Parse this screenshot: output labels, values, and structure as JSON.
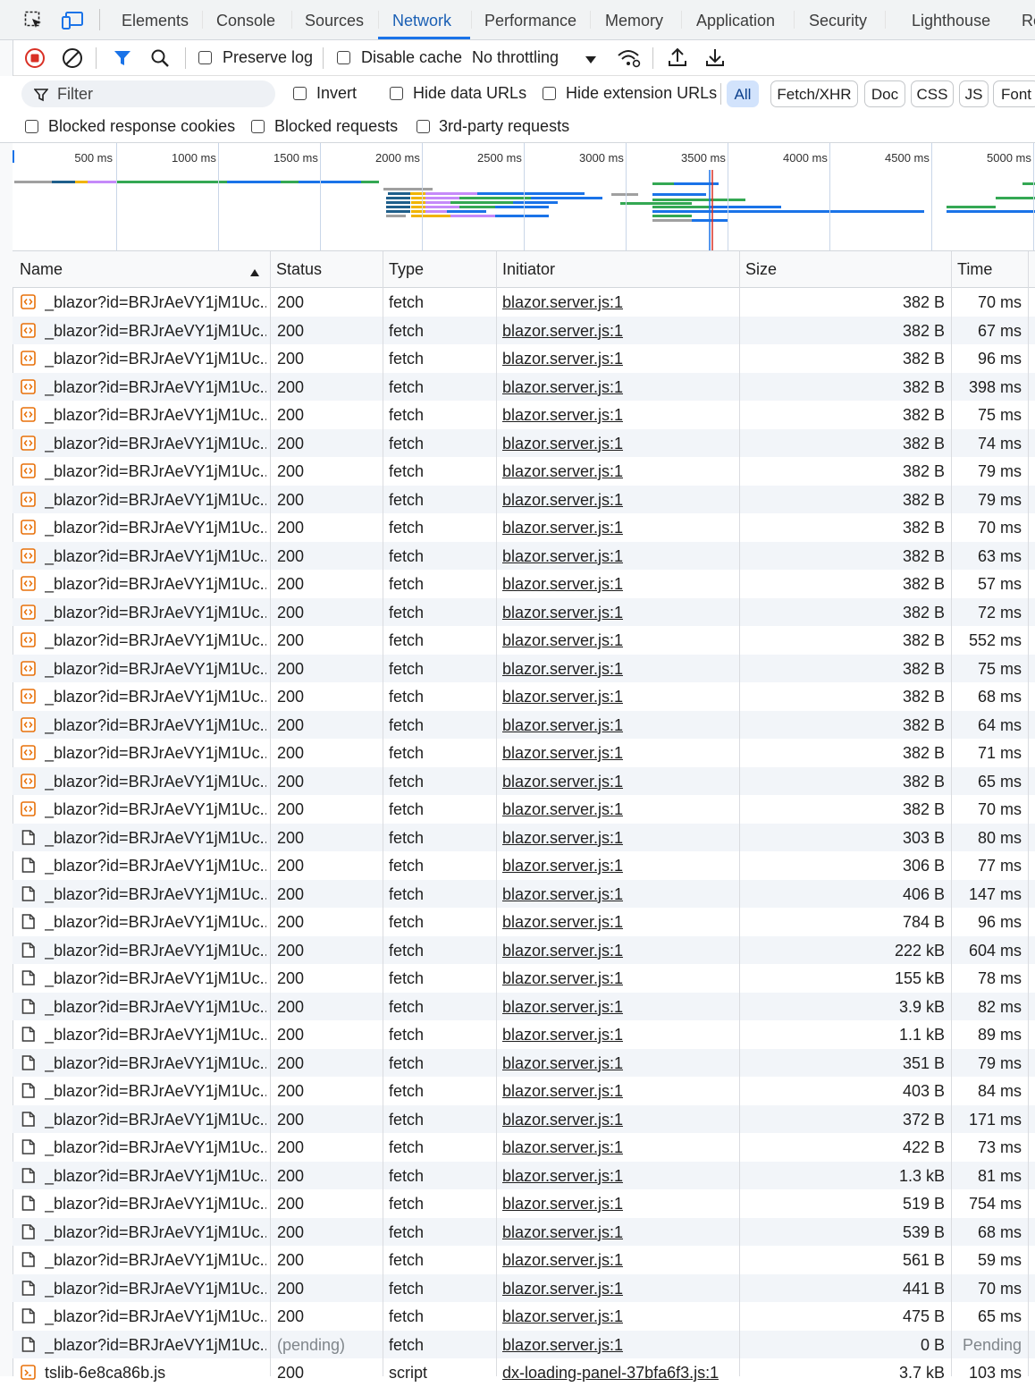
{
  "tabs": [
    {
      "label": "Elements"
    },
    {
      "label": "Console"
    },
    {
      "label": "Sources"
    },
    {
      "label": "Network"
    },
    {
      "label": "Performance"
    },
    {
      "label": "Memory"
    },
    {
      "label": "Application"
    },
    {
      "label": "Security"
    },
    {
      "label": "Lighthouse"
    },
    {
      "label": "Re"
    }
  ],
  "active_tab": "Network",
  "toolbar": {
    "preserve_log": "Preserve log",
    "disable_cache": "Disable cache",
    "throttling": "No throttling"
  },
  "filter": {
    "placeholder": "Filter",
    "invert": "Invert",
    "hide_data_urls": "Hide data URLs",
    "hide_extension_urls": "Hide extension URLs",
    "type_buttons": [
      "All",
      "Fetch/XHR",
      "Doc",
      "CSS",
      "JS",
      "Font"
    ],
    "active_type": "All",
    "blocked_response_cookies": "Blocked response cookies",
    "blocked_requests": "Blocked requests",
    "third_party_requests": "3rd-party requests"
  },
  "overview": {
    "ticks": [
      "500 ms",
      "1000 ms",
      "1500 ms",
      "2000 ms",
      "2500 ms",
      "3000 ms",
      "3500 ms",
      "4000 ms",
      "4500 ms",
      "5000 ms"
    ]
  },
  "columns": [
    "Name",
    "Status",
    "Type",
    "Initiator",
    "Size",
    "Time"
  ],
  "sort": {
    "column": "Name",
    "direction": "ascending"
  },
  "rows": [
    {
      "icon": "fetch",
      "name": "_blazor?id=BRJrAeVY1jM1Uc...",
      "status": "200",
      "type": "fetch",
      "initiator": "blazor.server.js:1",
      "size": "382 B",
      "time": "70 ms"
    },
    {
      "icon": "fetch",
      "name": "_blazor?id=BRJrAeVY1jM1Uc...",
      "status": "200",
      "type": "fetch",
      "initiator": "blazor.server.js:1",
      "size": "382 B",
      "time": "67 ms"
    },
    {
      "icon": "fetch",
      "name": "_blazor?id=BRJrAeVY1jM1Uc...",
      "status": "200",
      "type": "fetch",
      "initiator": "blazor.server.js:1",
      "size": "382 B",
      "time": "96 ms"
    },
    {
      "icon": "fetch",
      "name": "_blazor?id=BRJrAeVY1jM1Uc...",
      "status": "200",
      "type": "fetch",
      "initiator": "blazor.server.js:1",
      "size": "382 B",
      "time": "398 ms"
    },
    {
      "icon": "fetch",
      "name": "_blazor?id=BRJrAeVY1jM1Uc...",
      "status": "200",
      "type": "fetch",
      "initiator": "blazor.server.js:1",
      "size": "382 B",
      "time": "75 ms"
    },
    {
      "icon": "fetch",
      "name": "_blazor?id=BRJrAeVY1jM1Uc...",
      "status": "200",
      "type": "fetch",
      "initiator": "blazor.server.js:1",
      "size": "382 B",
      "time": "74 ms"
    },
    {
      "icon": "fetch",
      "name": "_blazor?id=BRJrAeVY1jM1Uc...",
      "status": "200",
      "type": "fetch",
      "initiator": "blazor.server.js:1",
      "size": "382 B",
      "time": "79 ms"
    },
    {
      "icon": "fetch",
      "name": "_blazor?id=BRJrAeVY1jM1Uc...",
      "status": "200",
      "type": "fetch",
      "initiator": "blazor.server.js:1",
      "size": "382 B",
      "time": "79 ms"
    },
    {
      "icon": "fetch",
      "name": "_blazor?id=BRJrAeVY1jM1Uc...",
      "status": "200",
      "type": "fetch",
      "initiator": "blazor.server.js:1",
      "size": "382 B",
      "time": "70 ms"
    },
    {
      "icon": "fetch",
      "name": "_blazor?id=BRJrAeVY1jM1Uc...",
      "status": "200",
      "type": "fetch",
      "initiator": "blazor.server.js:1",
      "size": "382 B",
      "time": "63 ms"
    },
    {
      "icon": "fetch",
      "name": "_blazor?id=BRJrAeVY1jM1Uc...",
      "status": "200",
      "type": "fetch",
      "initiator": "blazor.server.js:1",
      "size": "382 B",
      "time": "57 ms"
    },
    {
      "icon": "fetch",
      "name": "_blazor?id=BRJrAeVY1jM1Uc...",
      "status": "200",
      "type": "fetch",
      "initiator": "blazor.server.js:1",
      "size": "382 B",
      "time": "72 ms"
    },
    {
      "icon": "fetch",
      "name": "_blazor?id=BRJrAeVY1jM1Uc...",
      "status": "200",
      "type": "fetch",
      "initiator": "blazor.server.js:1",
      "size": "382 B",
      "time": "552 ms"
    },
    {
      "icon": "fetch",
      "name": "_blazor?id=BRJrAeVY1jM1Uc...",
      "status": "200",
      "type": "fetch",
      "initiator": "blazor.server.js:1",
      "size": "382 B",
      "time": "75 ms"
    },
    {
      "icon": "fetch",
      "name": "_blazor?id=BRJrAeVY1jM1Uc...",
      "status": "200",
      "type": "fetch",
      "initiator": "blazor.server.js:1",
      "size": "382 B",
      "time": "68 ms"
    },
    {
      "icon": "fetch",
      "name": "_blazor?id=BRJrAeVY1jM1Uc...",
      "status": "200",
      "type": "fetch",
      "initiator": "blazor.server.js:1",
      "size": "382 B",
      "time": "64 ms"
    },
    {
      "icon": "fetch",
      "name": "_blazor?id=BRJrAeVY1jM1Uc...",
      "status": "200",
      "type": "fetch",
      "initiator": "blazor.server.js:1",
      "size": "382 B",
      "time": "71 ms"
    },
    {
      "icon": "fetch",
      "name": "_blazor?id=BRJrAeVY1jM1Uc...",
      "status": "200",
      "type": "fetch",
      "initiator": "blazor.server.js:1",
      "size": "382 B",
      "time": "65 ms"
    },
    {
      "icon": "fetch",
      "name": "_blazor?id=BRJrAeVY1jM1Uc...",
      "status": "200",
      "type": "fetch",
      "initiator": "blazor.server.js:1",
      "size": "382 B",
      "time": "70 ms"
    },
    {
      "icon": "document",
      "name": "_blazor?id=BRJrAeVY1jM1Uc...",
      "status": "200",
      "type": "fetch",
      "initiator": "blazor.server.js:1",
      "size": "303 B",
      "time": "80 ms"
    },
    {
      "icon": "document",
      "name": "_blazor?id=BRJrAeVY1jM1Uc...",
      "status": "200",
      "type": "fetch",
      "initiator": "blazor.server.js:1",
      "size": "306 B",
      "time": "77 ms"
    },
    {
      "icon": "document",
      "name": "_blazor?id=BRJrAeVY1jM1Uc...",
      "status": "200",
      "type": "fetch",
      "initiator": "blazor.server.js:1",
      "size": "406 B",
      "time": "147 ms"
    },
    {
      "icon": "document",
      "name": "_blazor?id=BRJrAeVY1jM1Uc...",
      "status": "200",
      "type": "fetch",
      "initiator": "blazor.server.js:1",
      "size": "784 B",
      "time": "96 ms"
    },
    {
      "icon": "document",
      "name": "_blazor?id=BRJrAeVY1jM1Uc...",
      "status": "200",
      "type": "fetch",
      "initiator": "blazor.server.js:1",
      "size": "222 kB",
      "time": "604 ms"
    },
    {
      "icon": "document",
      "name": "_blazor?id=BRJrAeVY1jM1Uc...",
      "status": "200",
      "type": "fetch",
      "initiator": "blazor.server.js:1",
      "size": "155 kB",
      "time": "78 ms"
    },
    {
      "icon": "document",
      "name": "_blazor?id=BRJrAeVY1jM1Uc...",
      "status": "200",
      "type": "fetch",
      "initiator": "blazor.server.js:1",
      "size": "3.9 kB",
      "time": "82 ms"
    },
    {
      "icon": "document",
      "name": "_blazor?id=BRJrAeVY1jM1Uc...",
      "status": "200",
      "type": "fetch",
      "initiator": "blazor.server.js:1",
      "size": "1.1 kB",
      "time": "89 ms"
    },
    {
      "icon": "document",
      "name": "_blazor?id=BRJrAeVY1jM1Uc...",
      "status": "200",
      "type": "fetch",
      "initiator": "blazor.server.js:1",
      "size": "351 B",
      "time": "79 ms"
    },
    {
      "icon": "document",
      "name": "_blazor?id=BRJrAeVY1jM1Uc...",
      "status": "200",
      "type": "fetch",
      "initiator": "blazor.server.js:1",
      "size": "403 B",
      "time": "84 ms"
    },
    {
      "icon": "document",
      "name": "_blazor?id=BRJrAeVY1jM1Uc...",
      "status": "200",
      "type": "fetch",
      "initiator": "blazor.server.js:1",
      "size": "372 B",
      "time": "171 ms"
    },
    {
      "icon": "document",
      "name": "_blazor?id=BRJrAeVY1jM1Uc...",
      "status": "200",
      "type": "fetch",
      "initiator": "blazor.server.js:1",
      "size": "422 B",
      "time": "73 ms"
    },
    {
      "icon": "document",
      "name": "_blazor?id=BRJrAeVY1jM1Uc...",
      "status": "200",
      "type": "fetch",
      "initiator": "blazor.server.js:1",
      "size": "1.3 kB",
      "time": "81 ms"
    },
    {
      "icon": "document",
      "name": "_blazor?id=BRJrAeVY1jM1Uc...",
      "status": "200",
      "type": "fetch",
      "initiator": "blazor.server.js:1",
      "size": "519 B",
      "time": "754 ms"
    },
    {
      "icon": "document",
      "name": "_blazor?id=BRJrAeVY1jM1Uc...",
      "status": "200",
      "type": "fetch",
      "initiator": "blazor.server.js:1",
      "size": "539 B",
      "time": "68 ms"
    },
    {
      "icon": "document",
      "name": "_blazor?id=BRJrAeVY1jM1Uc...",
      "status": "200",
      "type": "fetch",
      "initiator": "blazor.server.js:1",
      "size": "561 B",
      "time": "59 ms"
    },
    {
      "icon": "document",
      "name": "_blazor?id=BRJrAeVY1jM1Uc...",
      "status": "200",
      "type": "fetch",
      "initiator": "blazor.server.js:1",
      "size": "441 B",
      "time": "70 ms"
    },
    {
      "icon": "document",
      "name": "_blazor?id=BRJrAeVY1jM1Uc...",
      "status": "200",
      "type": "fetch",
      "initiator": "blazor.server.js:1",
      "size": "475 B",
      "time": "65 ms"
    },
    {
      "icon": "document",
      "name": "_blazor?id=BRJrAeVY1jM1Uc...",
      "status": "(pending)",
      "type": "fetch",
      "initiator": "blazor.server.js:1",
      "size": "0 B",
      "time": "Pending"
    },
    {
      "icon": "script",
      "name": "tslib-6e8ca86b.js",
      "status": "200",
      "type": "script",
      "initiator": "dx-loading-panel-37bfa6f3.js:1",
      "size": "3.7 kB",
      "time": "103 ms"
    }
  ],
  "colors": {
    "accent": "#1a73e8",
    "record_red": "#d93025",
    "fetch_icon": "#e8710a",
    "row_alt": "#f2f5f9"
  }
}
